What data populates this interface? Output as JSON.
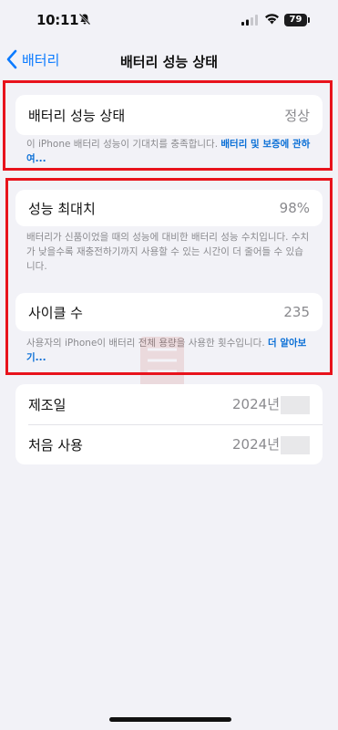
{
  "status_bar": {
    "time": "10:11",
    "battery": "79"
  },
  "nav": {
    "back_label": "배터리",
    "title": "배터리 성능 상태"
  },
  "health": {
    "label": "배터리 성능 상태",
    "value": "정상",
    "footer_text": "이 iPhone 배터리 성능이 기대치를 충족합니다. ",
    "footer_link": "배터리 및 보증에 관하여..."
  },
  "max_capacity": {
    "label": "성능 최대치",
    "value": "98%",
    "footer_text": "배터리가 신품이었을 때의 성능에 대비한 배터리 성능 수치입니다. 수치가 낮을수록 재충전하기까지 사용할 수 있는 시간이 더 줄어들 수 있습니다."
  },
  "cycle_count": {
    "label": "사이클 수",
    "value": "235",
    "footer_text": "사용자의 iPhone이 배터리 전체 용량을 사용한 횟수입니다. ",
    "footer_link": "더 알아보기..."
  },
  "info": {
    "manufacture_label": "제조일",
    "manufacture_value": "2024년",
    "first_use_label": "처음 사용",
    "first_use_value": "2024년"
  },
  "colors": {
    "accent": "#0a7aff",
    "highlight": "#e8131c",
    "background": "#f2f2f7"
  }
}
